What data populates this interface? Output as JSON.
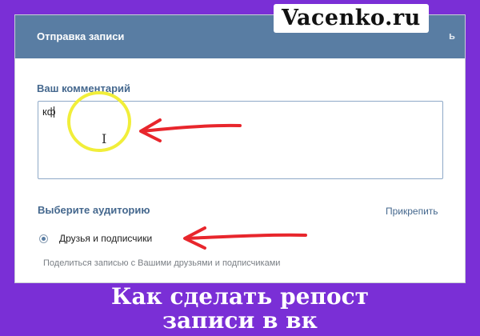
{
  "dialog": {
    "title": "Отправка записи",
    "close_label": "ь"
  },
  "watermark": "Vacenko.ru",
  "comment": {
    "label": "Ваш комментарий",
    "value": "кф"
  },
  "audience": {
    "label": "Выберите аудиторию",
    "attach_label": "Прикрепить",
    "option_label": "Друзья и подписчики",
    "option_selected": true,
    "hint": "Поделиться записью с Вашими друзьями и подписчиками"
  },
  "caption": {
    "line1": "Как сделать репост",
    "line2": "записи в вк"
  },
  "colors": {
    "background": "#7a2fd6",
    "header": "#597da3",
    "link": "#45688e",
    "annotation_arrow": "#e8262c",
    "annotation_circle": "#f1ee3a"
  }
}
